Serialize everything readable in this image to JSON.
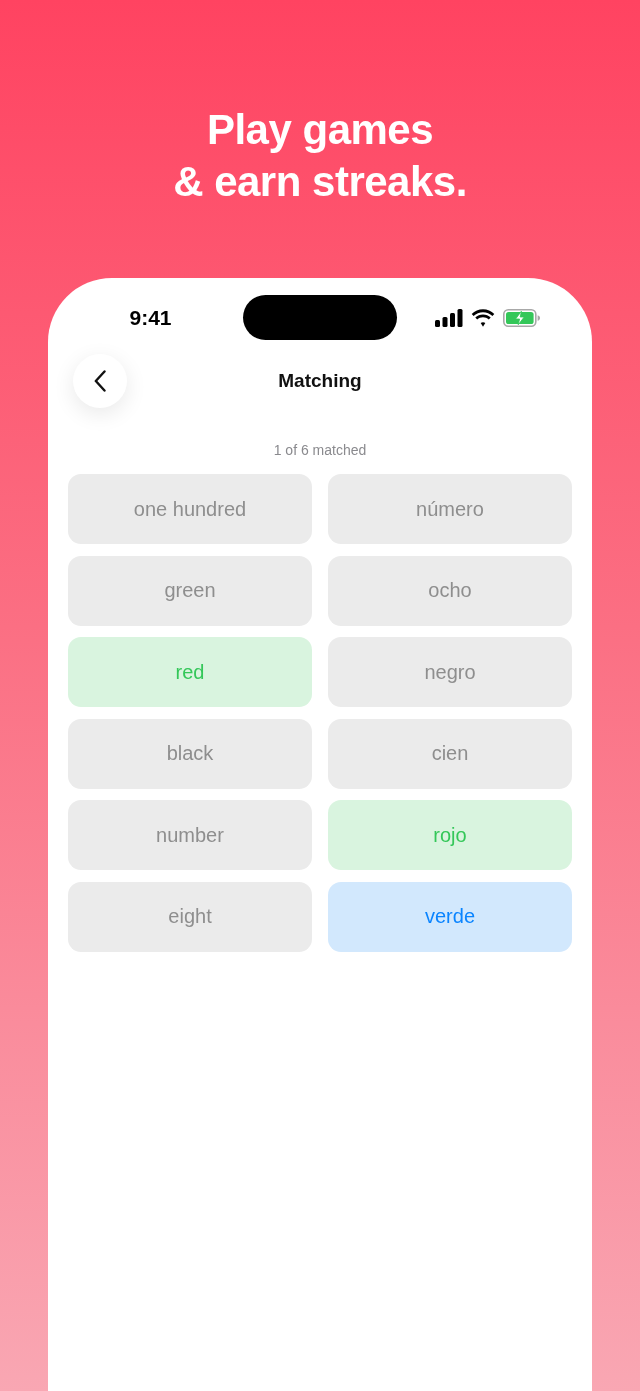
{
  "headline": "Play games\n& earn streaks.",
  "status_bar": {
    "time": "9:41"
  },
  "nav": {
    "title": "Matching"
  },
  "progress": "1 of 6 matched",
  "tiles": [
    {
      "label": "one hundred",
      "matched": false,
      "selected": false
    },
    {
      "label": "número",
      "matched": false,
      "selected": false
    },
    {
      "label": "green",
      "matched": false,
      "selected": false
    },
    {
      "label": "ocho",
      "matched": false,
      "selected": false
    },
    {
      "label": "red",
      "matched": true,
      "selected": false
    },
    {
      "label": "negro",
      "matched": false,
      "selected": false
    },
    {
      "label": "black",
      "matched": false,
      "selected": false
    },
    {
      "label": "cien",
      "matched": false,
      "selected": false
    },
    {
      "label": "number",
      "matched": false,
      "selected": false
    },
    {
      "label": "rojo",
      "matched": true,
      "selected": false
    },
    {
      "label": "eight",
      "matched": false,
      "selected": false
    },
    {
      "label": "verde",
      "matched": false,
      "selected": true
    }
  ]
}
